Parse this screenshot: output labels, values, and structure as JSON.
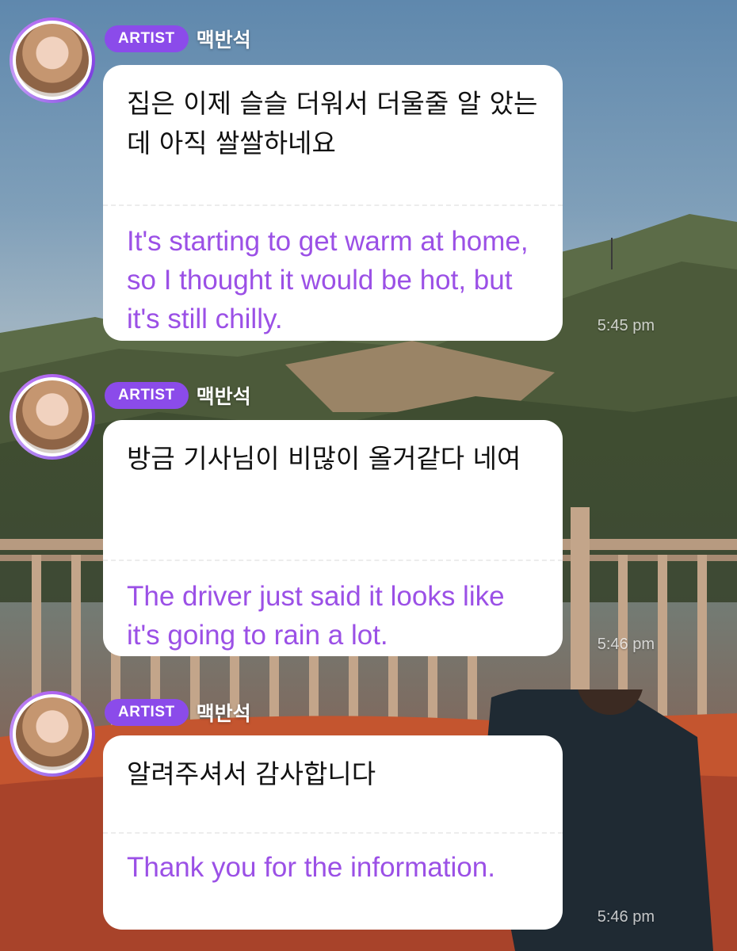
{
  "messages": [
    {
      "badge": "ARTIST",
      "name": "맥반석",
      "korean": "집은 이제 슬슬 더워서 더울줄 알 았는데 아직 쌀쌀하네요",
      "english": "It's starting to get warm at home, so I thought it would be hot, but it's still chilly.",
      "time": "5:45 pm"
    },
    {
      "badge": "ARTIST",
      "name": "맥반석",
      "korean": "방금 기사님이 비많이 올거같다 네여",
      "english": "The driver just said it looks like it's going to rain a lot.",
      "time": "5:46 pm"
    },
    {
      "badge": "ARTIST",
      "name": "맥반석",
      "korean": "알려주셔서 감사합니다",
      "english": "Thank you for the information.",
      "time": "5:46 pm"
    }
  ],
  "colors": {
    "badge": "#8b4bea",
    "translation_text": "#9b50e6",
    "avatar_ring": "#b066f0"
  },
  "icons": {
    "avatar": "artist-profile-photo"
  }
}
